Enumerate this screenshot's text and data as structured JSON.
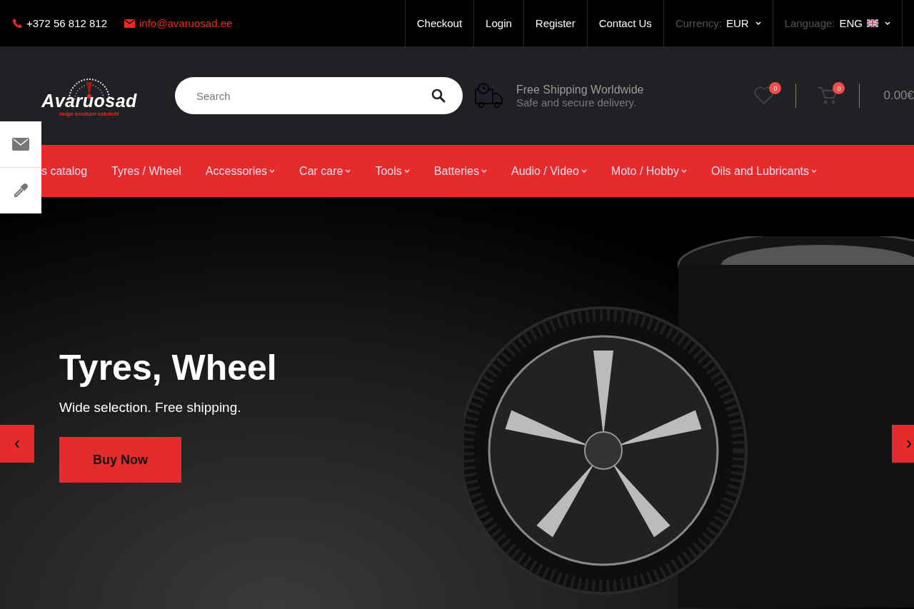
{
  "top_bar": {
    "phone": "+372 56 812 812",
    "email": "info@avaruosad.ee",
    "links": [
      "Checkout",
      "Login",
      "Register",
      "Contact Us"
    ],
    "currency": {
      "label": "Currency:",
      "value": "EUR"
    },
    "language": {
      "label": "Language:",
      "value": "ENG"
    }
  },
  "header": {
    "logo": {
      "name": "Avaruosad",
      "tagline": "hulga soodsam ostukoht"
    },
    "search": {
      "placeholder": "Search"
    },
    "shipping": {
      "title": "Free Shipping Worldwide",
      "subtitle": "Safe and secure delivery."
    },
    "wishlist": {
      "count": "0"
    },
    "cart": {
      "count": "0",
      "total": "0.00€"
    }
  },
  "nav": [
    {
      "label": "s catalog",
      "dropdown": false
    },
    {
      "label": "Tyres / Wheel",
      "dropdown": false
    },
    {
      "label": "Accessories",
      "dropdown": true
    },
    {
      "label": "Car care",
      "dropdown": true
    },
    {
      "label": "Tools",
      "dropdown": true
    },
    {
      "label": "Batteries",
      "dropdown": true
    },
    {
      "label": "Audio / Video",
      "dropdown": true
    },
    {
      "label": "Moto / Hobby",
      "dropdown": true
    },
    {
      "label": "Oils and Lubricants",
      "dropdown": true
    }
  ],
  "hero": {
    "title": "Tyres, Wheel",
    "subtitle": "Wide selection. Free shipping.",
    "button": "Buy Now"
  }
}
